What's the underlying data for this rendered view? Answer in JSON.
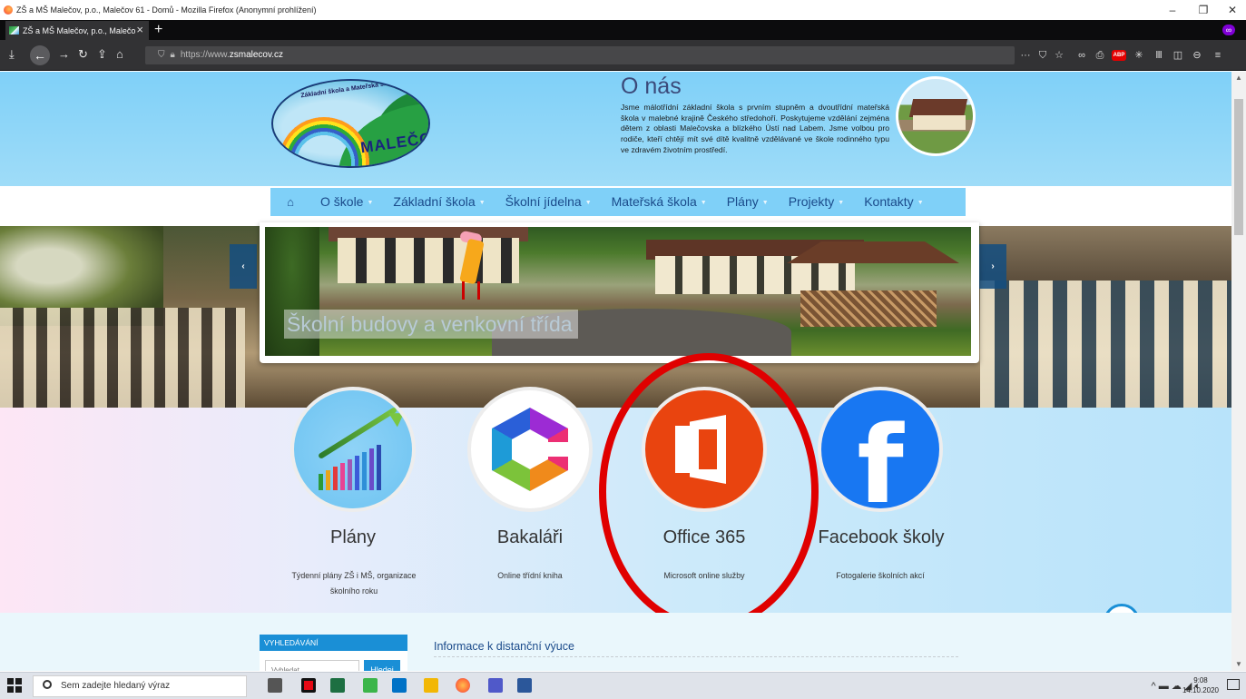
{
  "window": {
    "title": "ZŠ a MŠ Malečov, p.o., Malečov 61 - Domů - Mozilla Firefox (Anonymní prohlížení)",
    "tab_title": "ZŠ a MŠ Malečov, p.o., Malečo",
    "url_scheme": "https://www.",
    "url_host": "zsmalecov.cz"
  },
  "header": {
    "logo_arc": "Základní škola a Mateřská škola",
    "logo_word": "MALEČOV",
    "about_title": "O nás",
    "about_text": "Jsme málotřídní základní škola s prvním stupněm a dvoutřídní mateřská škola v malebné krajině Českého středohoří. Poskytujeme vzdělání zejména dětem z oblasti Malečovska a blízkého Ústí nad Labem. Jsme volbou pro rodiče, kteří chtějí mít své dítě kvalitně vzdělávané ve škole rodinného typu ve zdravém životním prostředí."
  },
  "menu": {
    "items": [
      {
        "label": "O škole"
      },
      {
        "label": "Základní škola"
      },
      {
        "label": "Školní jídelna"
      },
      {
        "label": "Mateřská škola"
      },
      {
        "label": "Plány"
      },
      {
        "label": "Projekty"
      },
      {
        "label": "Kontakty"
      }
    ]
  },
  "slider": {
    "caption": "Školní budovy a venkovní třída",
    "prev": "‹",
    "next": "›"
  },
  "services": [
    {
      "title": "Plány",
      "desc_line1": "Týdenní plány ZŠ i MŠ, organizace",
      "desc_line2": "školního roku"
    },
    {
      "title": "Bakaláři",
      "desc_line1": "Online třídní kniha"
    },
    {
      "title": "Office 365",
      "desc_line1": "Microsoft online služby"
    },
    {
      "title": "Facebook školy",
      "desc_line1": "Fotogalerie školních akcí"
    }
  ],
  "search": {
    "heading": "VYHLEDÁVÁNÍ",
    "placeholder": "Vyhledat",
    "button": "Hledej"
  },
  "info": {
    "title": "Informace k distanční výuce"
  },
  "taskbar": {
    "search_placeholder": "Sem zadejte hledaný výraz",
    "time": "9:08",
    "date": "14.10.2020"
  },
  "colors": {
    "header_blue": "#7fd0f8",
    "menu_text": "#1a4a8a",
    "office_orange": "#e9440f",
    "facebook_blue": "#1877f2",
    "highlight_red": "#e00000"
  }
}
